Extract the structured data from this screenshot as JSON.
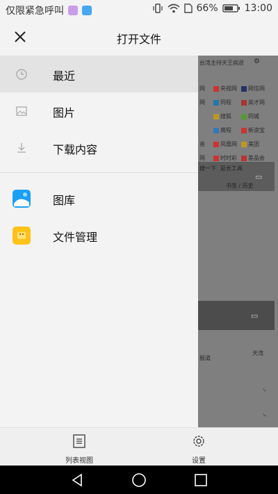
{
  "status_bar": {
    "left_text": "仅限紧急呼叫",
    "battery_percent": "66%",
    "time": "13:00",
    "icons": [
      "gallery-app-icon",
      "shield-app-icon",
      "vibrate-icon",
      "wifi-icon",
      "sim-icon",
      "battery-icon"
    ]
  },
  "header": {
    "title": "打开文件",
    "close_icon": "close-icon"
  },
  "drawer": {
    "items": [
      {
        "label": "最近",
        "icon": "clock-icon",
        "active": true
      },
      {
        "label": "图片",
        "icon": "image-icon",
        "active": false
      },
      {
        "label": "下载内容",
        "icon": "download-icon",
        "active": false
      }
    ],
    "apps": [
      {
        "label": "图库",
        "icon": "gallery-icon"
      },
      {
        "label": "文件管理",
        "icon": "file-manager-icon"
      }
    ]
  },
  "background": {
    "top_link": "台湾主持天王病逝",
    "grid": [
      [
        "网",
        "央视网",
        "网信网"
      ],
      [
        "网",
        "同程",
        "英才网"
      ],
      [
        "",
        "搜狐",
        "同城"
      ],
      [
        "",
        "携程",
        "新浪宝"
      ],
      [
        "音",
        "凤凰网",
        "美团"
      ],
      [
        "网",
        "时时彩",
        "差品会"
      ]
    ],
    "search_row": "搜一下",
    "tools": "延长工具",
    "footer_text": "书签 / 历史",
    "region_label": "天湾",
    "news_snippet": "报道"
  },
  "bottom_bar": {
    "left": {
      "label": "列表视图",
      "icon": "list-view-icon"
    },
    "right": {
      "label": "设置",
      "icon": "settings-icon"
    }
  },
  "nav_bar": {
    "icons": [
      "back-icon",
      "home-icon",
      "recents-icon"
    ]
  },
  "colors": {
    "accent_gallery": "#1aa0f4",
    "accent_files": "#ffc21a",
    "drawer_bg": "#f3f3f3",
    "active_bg": "#e3e3e3"
  }
}
